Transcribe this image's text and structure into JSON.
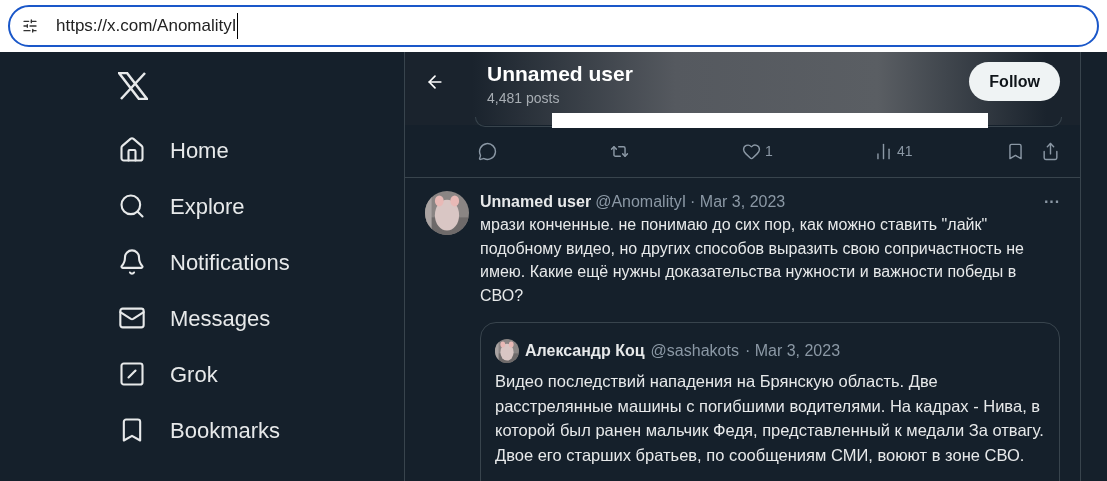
{
  "address_bar": {
    "url": "https://x.com/AnomalityI"
  },
  "sidebar": {
    "items": [
      {
        "kind": "home",
        "label": "Home"
      },
      {
        "kind": "explore",
        "label": "Explore"
      },
      {
        "kind": "notifications",
        "label": "Notifications"
      },
      {
        "kind": "messages",
        "label": "Messages"
      },
      {
        "kind": "grok",
        "label": "Grok"
      },
      {
        "kind": "bookmarks",
        "label": "Bookmarks"
      }
    ]
  },
  "header": {
    "title": "Unnamed user",
    "posts": "4,481 posts",
    "follow": "Follow"
  },
  "previous_post": {
    "actions": [
      {
        "kind": "reply"
      },
      {
        "kind": "repost"
      },
      {
        "kind": "like",
        "count": "1"
      },
      {
        "kind": "views",
        "count": "41"
      }
    ]
  },
  "post": {
    "name": "Unnamed user",
    "handle": "@AnomalityI",
    "date": "· Mar 3, 2023",
    "more": "···",
    "text": "мрази конченные. не понимаю до сих пор, как можно ставить \"лайк\" подобному видео, но других способов выразить свою сопричастность не имею. Какие ещё нужны доказательства нужности и важности победы в СВО?",
    "quote": {
      "name": "Александр Коц",
      "handle": "@sashakots",
      "date": "· Mar 3, 2023",
      "text": "Видео последствий нападения на Брянскую область. Две расстрелянные машины с погибшими водителями. На кадрах - Нива, в которой был ранен мальчик Федя, представленный к медали За отвагу. Двое его старших братьев, по сообщениям СМИ, воюют в зоне СВО."
    }
  }
}
